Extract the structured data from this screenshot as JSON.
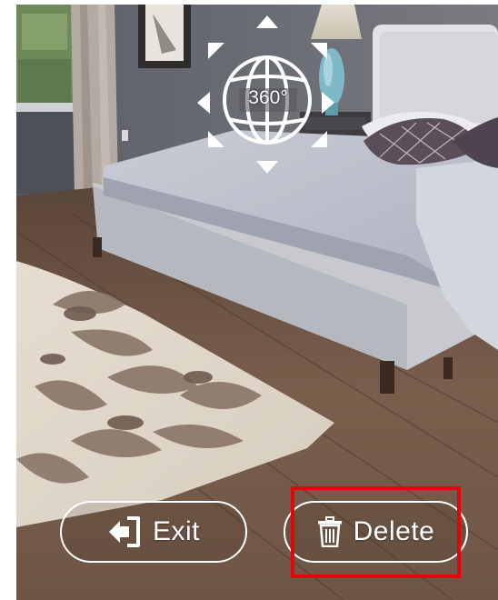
{
  "viewer": {
    "mode_label": "360°",
    "exit_label": "Exit",
    "delete_label": "Delete",
    "exit_icon": "exit-door-icon",
    "delete_icon": "trash-icon",
    "highlight_color": "#e8000b"
  }
}
